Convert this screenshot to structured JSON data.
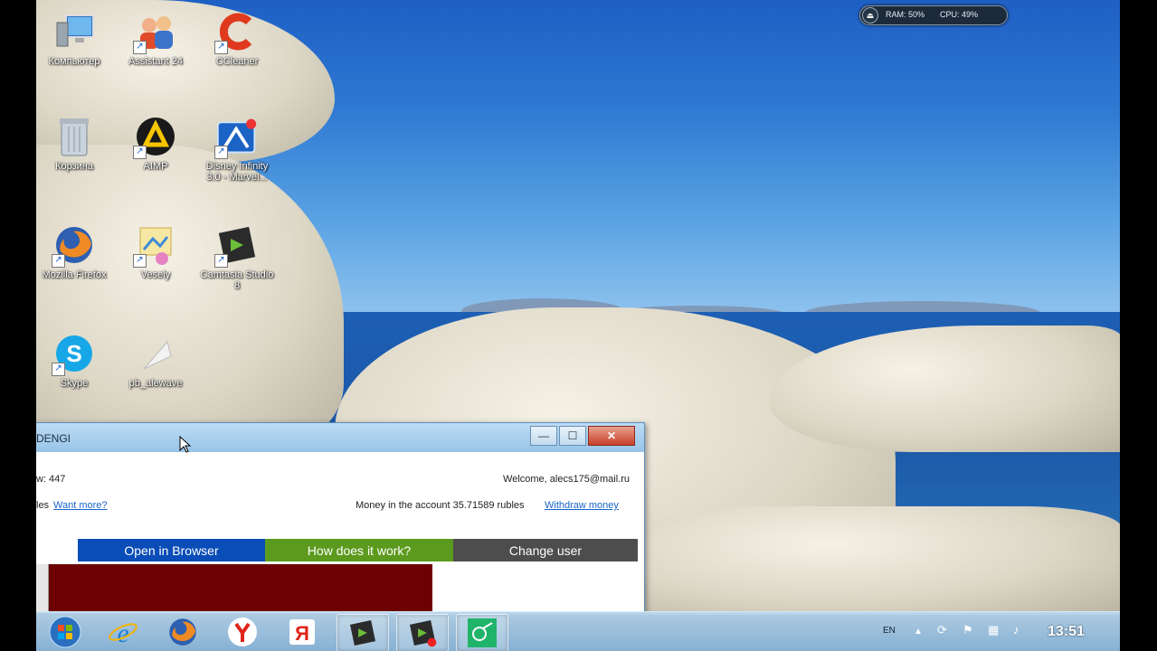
{
  "desktop": {
    "icons": [
      {
        "label": "Компьютер",
        "icon": "computer-icon"
      },
      {
        "label": "Assistant 24",
        "icon": "assistant-icon"
      },
      {
        "label": "CCleaner",
        "icon": "ccleaner-icon"
      },
      {
        "label": "Корзина",
        "icon": "recycle-bin-icon"
      },
      {
        "label": "AIMP",
        "icon": "aimp-icon"
      },
      {
        "label": "Disney Infinity 3.0 - Marvel...",
        "icon": "disney-infinity-icon"
      },
      {
        "label": "Mozilla Firefox",
        "icon": "firefox-icon"
      },
      {
        "label": "Vesely",
        "icon": "vesely-icon"
      },
      {
        "label": "Camtasia Studio 8",
        "icon": "camtasia-icon"
      },
      {
        "label": "Skype",
        "icon": "skype-icon"
      },
      {
        "label": "pb_alewave",
        "icon": "file-icon"
      }
    ]
  },
  "widget": {
    "ram": "RAM: 50%",
    "cpu": "CPU: 49%"
  },
  "window": {
    "title": "DENGI",
    "buttons": {
      "minimize": "—",
      "maximize": "☐",
      "close": "✕"
    },
    "info": {
      "counter": "w: 447",
      "welcome": "Welcome, alecs175@mail.ru",
      "left_partial": "les",
      "want_more": "Want more?",
      "money_text": "Money in the account 35.71589 rubles",
      "withdraw": "Withdraw money"
    },
    "nav": [
      {
        "label": "Open in Browser",
        "color": "#0a4db8"
      },
      {
        "label": "How does it work?",
        "color": "#5c9a1e"
      },
      {
        "label": "Change user",
        "color": "#4d4d4d"
      }
    ]
  },
  "taskbar": {
    "buttons": [
      {
        "name": "start-button",
        "icon": "windows-logo-icon"
      },
      {
        "name": "internet-explorer",
        "icon": "ie-icon"
      },
      {
        "name": "firefox",
        "icon": "firefox-icon"
      },
      {
        "name": "yandex-browser",
        "icon": "yandex-browser-icon"
      },
      {
        "name": "yandex",
        "icon": "yandex-icon"
      },
      {
        "name": "camtasia",
        "icon": "camtasia-icon"
      },
      {
        "name": "camtasia-recorder",
        "icon": "camtasia-recorder-icon"
      },
      {
        "name": "dengi-app",
        "icon": "dengi-icon"
      }
    ],
    "lang": "EN",
    "clock": "13:51"
  }
}
